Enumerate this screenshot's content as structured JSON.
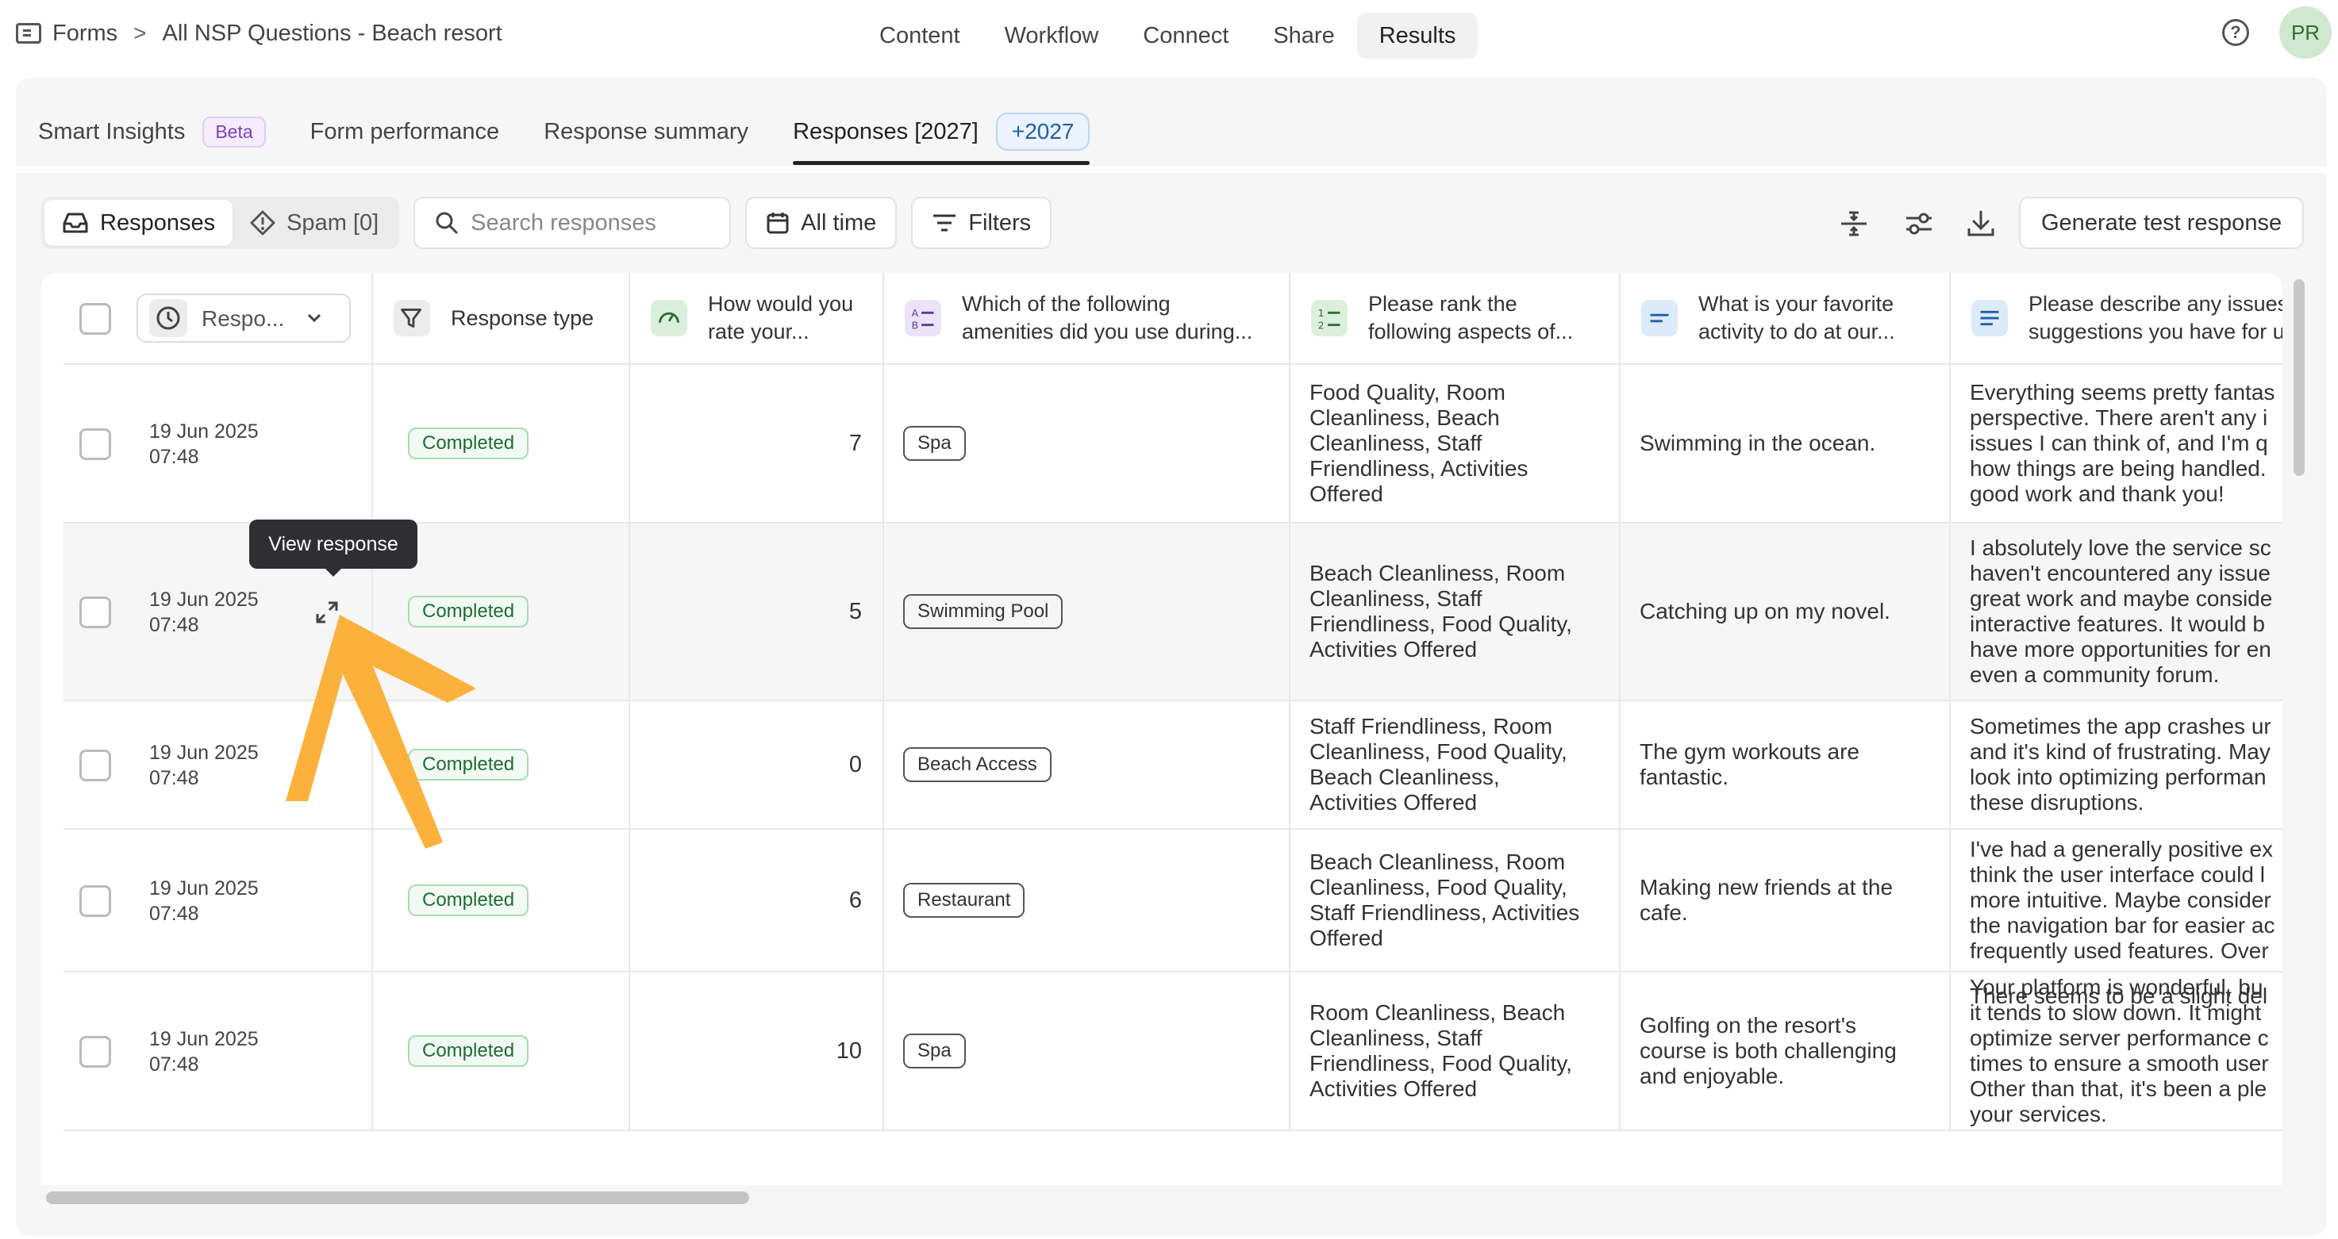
{
  "breadcrumb": {
    "root": "Forms",
    "separator": ">",
    "current": "All NSP Questions - Beach resort"
  },
  "top_nav": {
    "items": [
      "Content",
      "Workflow",
      "Connect",
      "Share",
      "Results"
    ],
    "active": "Results"
  },
  "user": {
    "initials": "PR"
  },
  "sub_tabs": {
    "smart_insights": "Smart Insights",
    "beta": "Beta",
    "form_performance": "Form performance",
    "response_summary": "Response summary",
    "responses": "Responses [2027]",
    "responses_count": "+2027"
  },
  "toolbar": {
    "responses": "Responses",
    "spam": "Spam [0]",
    "search_placeholder": "Search responses",
    "all_time": "All time",
    "filters": "Filters",
    "generate": "Generate test response"
  },
  "table": {
    "columns": {
      "sort": "Respo...",
      "type": "Response type",
      "rating": [
        "How would you",
        "rate your..."
      ],
      "amenities": [
        "Which of the following",
        "amenities did you use during..."
      ],
      "rank": [
        "Please rank the",
        "following aspects of..."
      ],
      "activity": [
        "What is your favorite",
        "activity to do at our..."
      ],
      "issues": [
        "Please describe any issues",
        "suggestions you have for u"
      ]
    },
    "rows": [
      {
        "date": "19 Jun 2025",
        "time": "07:48",
        "status": "Completed",
        "rating": "7",
        "amenity": "Spa",
        "rank": [
          "Food Quality, Room",
          "Cleanliness, Beach",
          "Cleanliness, Staff",
          "Friendliness, Activities",
          "Offered"
        ],
        "activity": [
          "Swimming in the ocean."
        ],
        "issues": [
          "Everything seems pretty fantas",
          "perspective. There aren't any i",
          "issues I can think of, and I'm q",
          "how things are being handled.",
          "good work and thank you!"
        ]
      },
      {
        "date": "19 Jun 2025",
        "time": "07:48",
        "status": "Completed",
        "rating": "5",
        "amenity": "Swimming Pool",
        "rank": [
          "Beach Cleanliness, Room",
          "Cleanliness, Staff",
          "Friendliness, Food Quality,",
          "Activities Offered"
        ],
        "activity": [
          "Catching up on my novel."
        ],
        "issues": [
          "I absolutely love the service sc",
          "haven't encountered any issue",
          "great work and maybe conside",
          "interactive features. It would b",
          "have more opportunities for en",
          "even a community forum."
        ]
      },
      {
        "date": "19 Jun 2025",
        "time": "07:48",
        "status": "Completed",
        "rating": "0",
        "amenity": "Beach Access",
        "rank": [
          "Staff Friendliness, Room",
          "Cleanliness, Food Quality,",
          "Beach Cleanliness,",
          "Activities Offered"
        ],
        "activity": [
          "The gym workouts are",
          "fantastic."
        ],
        "issues": [
          "Sometimes the app crashes ur",
          "and it's kind of frustrating. May",
          "look into optimizing performan",
          "these disruptions."
        ]
      },
      {
        "date": "19 Jun 2025",
        "time": "07:48",
        "status": "Completed",
        "rating": "6",
        "amenity": "Restaurant",
        "rank": [
          "Beach Cleanliness, Room",
          "Cleanliness, Food Quality,",
          "Staff Friendliness, Activities",
          "Offered"
        ],
        "activity": [
          "Making new friends at the",
          "cafe."
        ],
        "issues": [
          "I've had a generally positive ex",
          "think the user interface could l",
          "more intuitive. Maybe consider",
          "the navigation bar for easier ac",
          "frequently used features. Over"
        ]
      },
      {
        "date": "19 Jun 2025",
        "time": "07:48",
        "status": "Completed",
        "rating": "10",
        "amenity": "Spa",
        "rank": [
          "Room Cleanliness, Beach",
          "Cleanliness, Staff",
          "Friendliness, Food Quality,",
          "Activities Offered"
        ],
        "activity": [
          "Golfing on the resort's",
          "course is both challenging",
          "and enjoyable."
        ],
        "issues": [
          "Your platform is wonderful, bu",
          "it tends to slow down. It might",
          "optimize server performance c",
          "times to ensure a smooth user",
          "Other than that, it's been a ple",
          "your services."
        ]
      }
    ],
    "partial_next": "There seems to be a slight del"
  },
  "tooltip": "View response",
  "colors": {
    "accent_arrow": "#FBB13C",
    "completed_green": "#1f6b34",
    "pill_blue": "#1f5fa8",
    "beta_purple": "#7a3fb8"
  }
}
